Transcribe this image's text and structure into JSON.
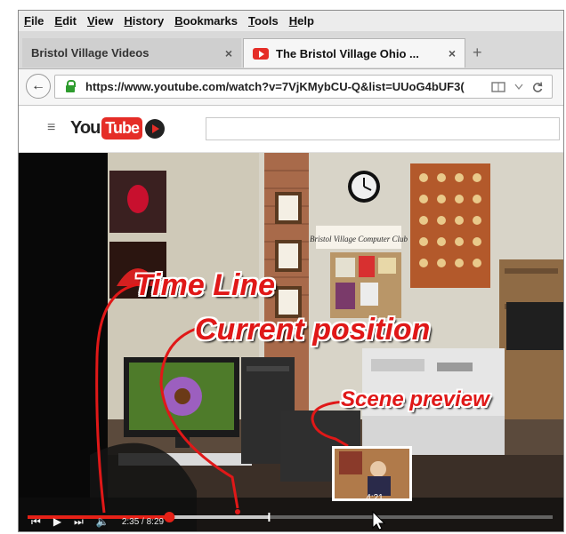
{
  "menu": [
    "File",
    "Edit",
    "View",
    "History",
    "Bookmarks",
    "Tools",
    "Help"
  ],
  "tabs": [
    {
      "title": "Bristol Village Videos",
      "close": "×"
    },
    {
      "title": "The Bristol Village Ohio ...",
      "close": "×"
    }
  ],
  "new_tab": "+",
  "nav": {
    "url": "https://www.youtube.com/watch?v=7VjKMybCU-Q&list=UUoG4bUF3(",
    "back_glyph": "←"
  },
  "youtube": {
    "logo_you": "You",
    "logo_tube": "Tube",
    "hamburger": "≡"
  },
  "video": {
    "club_sign": "Bristol Village Computer Club",
    "player_time": "2:35 / 8:29",
    "preview_time": "4:21",
    "progress_fraction": 0.27,
    "preview_fraction": 0.46
  },
  "annotations": {
    "timeline": "Time Line",
    "current": "Current position",
    "preview": "Scene preview"
  },
  "colors": {
    "accent": "#e01818",
    "progress": "#e62117"
  }
}
